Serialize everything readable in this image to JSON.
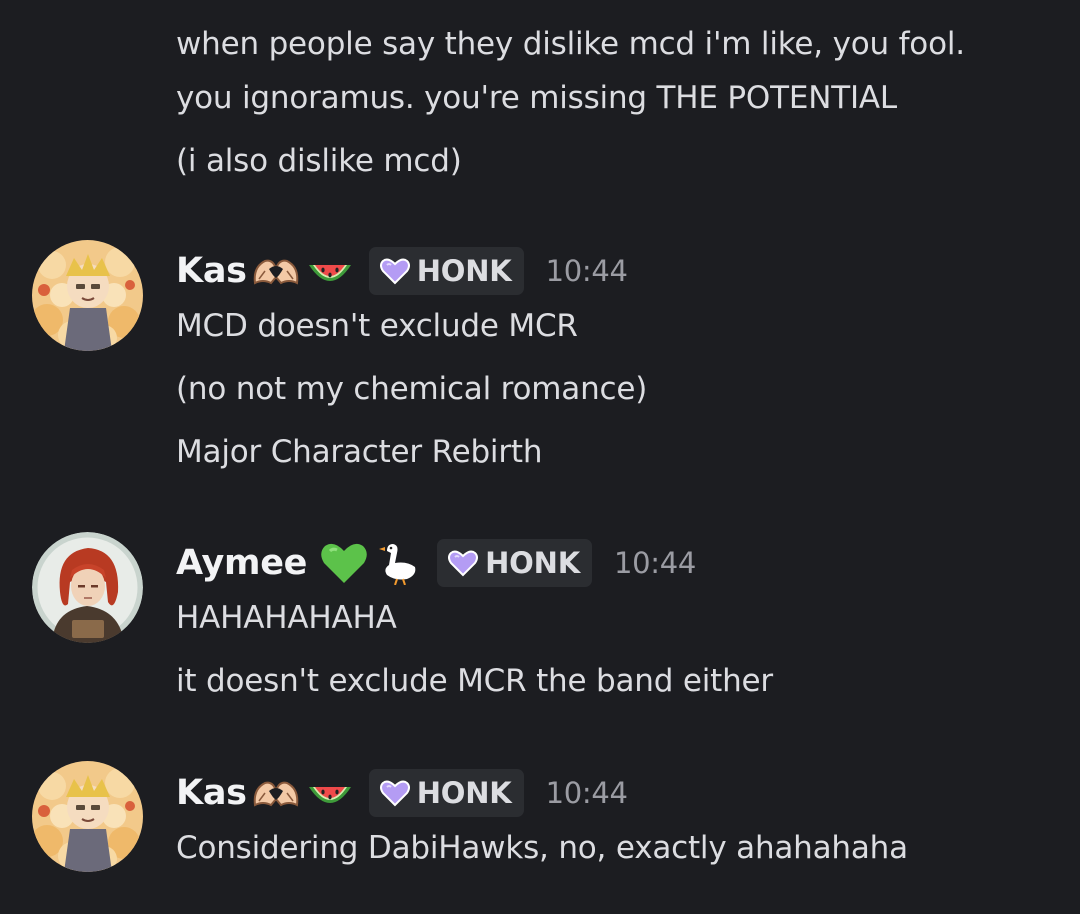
{
  "continuation": {
    "lines": [
      "when people say they dislike mcd i'm like, you fool.",
      "you ignoramus. you're  missing THE POTENTIAL",
      "(i also dislike mcd)"
    ]
  },
  "messages": [
    {
      "author": "Kas",
      "emojis": [
        "heart-hands-emoji",
        "watermelon-emoji"
      ],
      "role": {
        "label": "HONK",
        "icon": "purple-heart-icon",
        "color": "#b49cf4"
      },
      "time": "10:44",
      "lines": [
        "MCD doesn't exclude MCR",
        "(no not my chemical romance)",
        "Major Character Rebirth"
      ]
    },
    {
      "author": "Aymee",
      "emojis": [
        "green-heart-emoji",
        "goose-emoji"
      ],
      "role": {
        "label": "HONK",
        "icon": "purple-heart-icon",
        "color": "#b49cf4"
      },
      "time": "10:44",
      "lines": [
        "HAHAHAHAHA",
        "it doesn't exclude MCR the band either"
      ]
    },
    {
      "author": "Kas",
      "emojis": [
        "heart-hands-emoji",
        "watermelon-emoji"
      ],
      "role": {
        "label": "HONK",
        "icon": "purple-heart-icon",
        "color": "#b49cf4"
      },
      "time": "10:44",
      "lines": [
        "Considering DabiHawks, no, exactly ahahahaha"
      ]
    }
  ],
  "colors": {
    "background": "#1c1d21",
    "text": "#dcdde1",
    "username": "#f2f3f5",
    "timestamp": "#9b9ca3",
    "tag_bg": "#2b2d31"
  }
}
